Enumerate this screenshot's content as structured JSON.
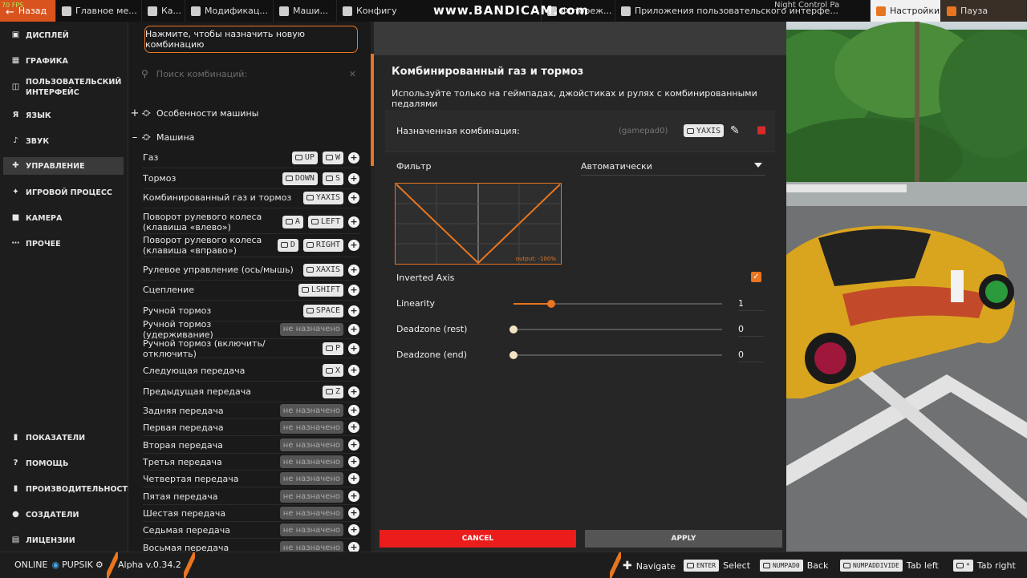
{
  "topbar": {
    "fps": "70 FPS",
    "back": "Назад",
    "tabs": [
      "Главное ме...",
      "Ка...",
      "Модификац...",
      "Маши...",
      "Конфигу",
      "Фотореж...",
      "Приложения пользовательского интерфе..."
    ],
    "active_tab": "Настройки",
    "pause": "Пауза",
    "watermark": "www.BANDICAM.com",
    "night_control": "Night Control Pa"
  },
  "sidebar": {
    "items": [
      {
        "label": "Дисплей",
        "icon": "monitor-icon"
      },
      {
        "label": "Графика",
        "icon": "image-icon"
      },
      {
        "label": "Пользовательский интерфейс",
        "icon": "layout-icon"
      },
      {
        "label": "Язык",
        "icon": "translate-icon"
      },
      {
        "label": "Звук",
        "icon": "speaker-icon"
      },
      {
        "label": "Управление",
        "icon": "gamepad-icon"
      },
      {
        "label": "Игровой процесс",
        "icon": "puzzle-icon"
      },
      {
        "label": "Камера",
        "icon": "camera-icon"
      },
      {
        "label": "Прочее",
        "icon": "dots-icon"
      }
    ],
    "bottom_items": [
      {
        "label": "Показатели",
        "icon": "bar-chart-icon"
      },
      {
        "label": "Помощь",
        "icon": "help-icon"
      },
      {
        "label": "Производительность",
        "icon": "bar-chart-icon"
      },
      {
        "label": "Создатели",
        "icon": "people-icon"
      },
      {
        "label": "Лицензии",
        "icon": "license-icon"
      }
    ]
  },
  "bindings": {
    "assign_button": "Нажмите, чтобы назначить новую комбинацию",
    "search_placeholder": "Поиск комбинаций:",
    "categories": [
      {
        "label": "Особенности машины",
        "sign": "+"
      },
      {
        "label": "Машина",
        "sign": "–"
      }
    ],
    "rows": [
      {
        "label": "Газ",
        "keys": [
          {
            "t": "UP",
            "g": true
          },
          {
            "t": "W",
            "g": true
          }
        ]
      },
      {
        "label": "Тормоз",
        "keys": [
          {
            "t": "DOWN",
            "g": true
          },
          {
            "t": "S",
            "g": true
          }
        ]
      },
      {
        "label": "Комбинированный газ и тормоз",
        "keys": [
          {
            "t": "YAXIS",
            "g": true
          }
        ]
      },
      {
        "label": "Поворот рулевого колеса (клавиша «влево»)",
        "keys": [
          {
            "t": "A",
            "g": true
          },
          {
            "t": "LEFT",
            "g": true
          }
        ]
      },
      {
        "label": "Поворот рулевого колеса (клавиша «вправо»)",
        "keys": [
          {
            "t": "D",
            "g": true
          },
          {
            "t": "RIGHT",
            "g": true
          }
        ]
      },
      {
        "label": "Рулевое управление (ось/мышь)",
        "keys": [
          {
            "t": "XAXIS",
            "g": true
          }
        ]
      },
      {
        "label": "Сцепление",
        "keys": [
          {
            "t": "LSHIFT",
            "g": true
          }
        ]
      },
      {
        "label": "Ручной тормоз",
        "keys": [
          {
            "t": "SPACE",
            "g": true
          }
        ]
      },
      {
        "label": "Ручной тормоз (удерживание)",
        "keys": [
          {
            "t": "не назначено",
            "na": true
          }
        ]
      },
      {
        "label": "Ручной тормоз (включить/отключить)",
        "keys": [
          {
            "t": "P",
            "g": true
          }
        ]
      },
      {
        "label": "Следующая передача",
        "keys": [
          {
            "t": "X",
            "g": true
          }
        ]
      },
      {
        "label": "Предыдущая передача",
        "keys": [
          {
            "t": "Z",
            "g": true
          }
        ]
      },
      {
        "label": "Задняя передача",
        "keys": [
          {
            "t": "не назначено",
            "na": true
          }
        ]
      },
      {
        "label": "Первая передача",
        "keys": [
          {
            "t": "не назначено",
            "na": true
          }
        ]
      },
      {
        "label": "Вторая передача",
        "keys": [
          {
            "t": "не назначено",
            "na": true
          }
        ]
      },
      {
        "label": "Третья передача",
        "keys": [
          {
            "t": "не назначено",
            "na": true
          }
        ]
      },
      {
        "label": "Четвертая передача",
        "keys": [
          {
            "t": "не назначено",
            "na": true
          }
        ]
      },
      {
        "label": "Пятая передача",
        "keys": [
          {
            "t": "не назначено",
            "na": true
          }
        ]
      },
      {
        "label": "Шестая передача",
        "keys": [
          {
            "t": "не назначено",
            "na": true
          }
        ]
      },
      {
        "label": "Седьмая передача",
        "keys": [
          {
            "t": "не назначено",
            "na": true
          }
        ]
      },
      {
        "label": "Восьмая передача",
        "keys": [
          {
            "t": "не назначено",
            "na": true
          }
        ]
      }
    ]
  },
  "detail": {
    "title": "Комбинированный газ и тормоз",
    "subtitle": "Используйте только на геймпадах, джойстиках и рулях с комбинированными педалями",
    "assigned_label": "Назначенная комбинация:",
    "device": "(gamepad0)",
    "assigned_key": "YAXIS",
    "filter_label": "Фильтр",
    "filter_value": "Автоматически",
    "graph_output": "output: -100%",
    "inverted_axis_label": "Inverted Axis",
    "inverted_axis_checked": true,
    "sliders": [
      {
        "label": "Linearity",
        "value": "1",
        "fraction": 0.18
      },
      {
        "label": "Deadzone (rest)",
        "value": "0",
        "fraction": 0
      },
      {
        "label": "Deadzone (end)",
        "value": "0",
        "fraction": 0
      }
    ],
    "cancel": "CANCEL",
    "apply": "APPLY"
  },
  "statusbar": {
    "online": "ONLINE",
    "user": "PUPSIK",
    "version": "Alpha v.0.34.2",
    "hints": [
      {
        "key": "",
        "label": "Navigate"
      },
      {
        "key": "ENTER",
        "label": "Select"
      },
      {
        "key": "NUMPAD0",
        "label": "Back"
      },
      {
        "key": "NUMPADDIVIDE",
        "label": "Tab left"
      },
      {
        "key": "*",
        "label": "Tab right"
      }
    ]
  },
  "colors": {
    "accent": "#e8751f",
    "cancel": "#ea1c1c",
    "trash": "#d62b2b"
  }
}
